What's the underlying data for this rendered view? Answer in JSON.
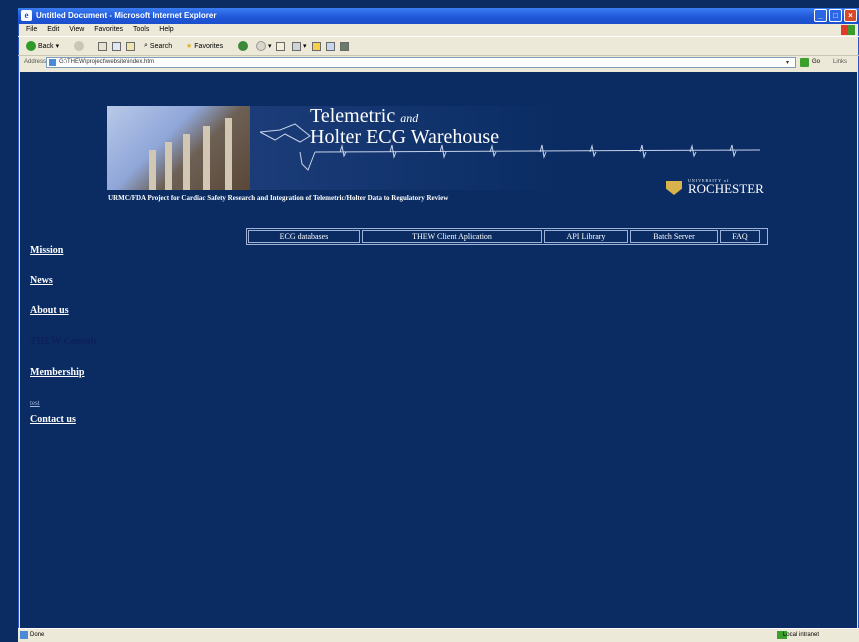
{
  "window": {
    "title": "Untitled Document - Microsoft Internet Explorer"
  },
  "menu": [
    "File",
    "Edit",
    "View",
    "Favorites",
    "Tools",
    "Help"
  ],
  "toolbar": {
    "back_label": "Back",
    "search_label": "Search",
    "favorites_label": "Favorites"
  },
  "address": {
    "label": "Address",
    "url": "G:\\THEW\\project\\website\\index.htm",
    "go_label": "Go",
    "links_label": "Links"
  },
  "header": {
    "title_line1": "Telemetric",
    "title_and": "and",
    "title_line2": "Holter ECG Warehouse",
    "subtitle": "URMC/FDA Project for Cardiac Safety Research and Integration of Telemetric/Holter Data to Regulatory Review",
    "logo_university": "UNIVERSITY of",
    "logo_name": "ROCHESTER"
  },
  "topnav": [
    {
      "label": "ECG databases"
    },
    {
      "label": "THEW Client Aplication"
    },
    {
      "label": "API Library"
    },
    {
      "label": "Batch Server"
    },
    {
      "label": "FAQ"
    }
  ],
  "sidenav": {
    "mission": "Mission",
    "news": "News",
    "about": "About us",
    "thew_consult": "THEW Consult",
    "membership": "Membership",
    "test": "test",
    "contact": "Contact us"
  },
  "status": {
    "left": "Done",
    "zone": "Local intranet"
  }
}
